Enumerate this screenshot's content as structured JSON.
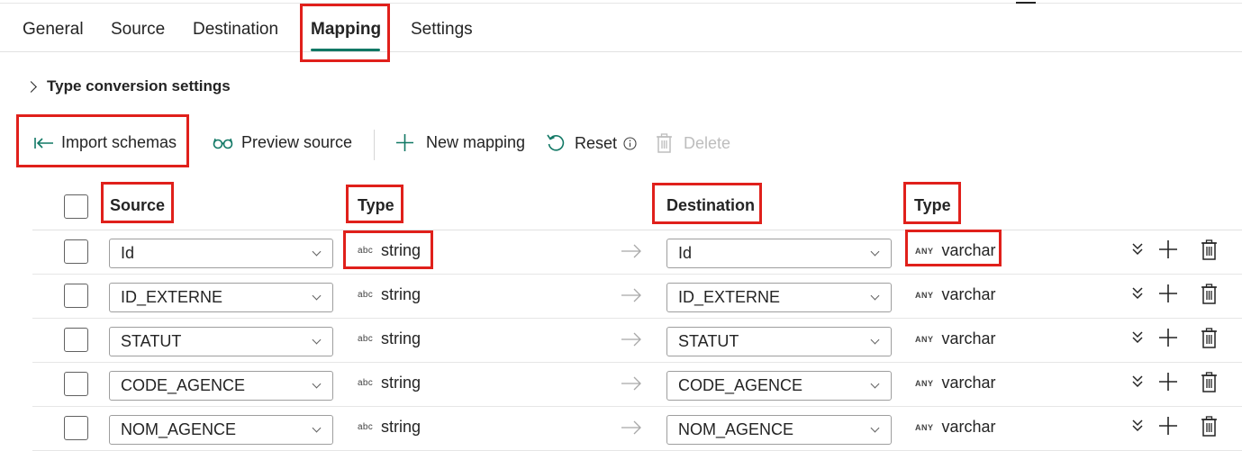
{
  "tabs": [
    {
      "label": "General"
    },
    {
      "label": "Source"
    },
    {
      "label": "Destination"
    },
    {
      "label": "Mapping",
      "active": true
    },
    {
      "label": "Settings"
    }
  ],
  "type_conversion": {
    "label": "Type conversion settings"
  },
  "toolbar": {
    "import_schemas": "Import schemas",
    "preview_source": "Preview source",
    "new_mapping": "New mapping",
    "reset": "Reset",
    "delete": "Delete"
  },
  "headers": {
    "source": "Source",
    "source_type": "Type",
    "destination": "Destination",
    "destination_type": "Type"
  },
  "rows": [
    {
      "source": "Id",
      "source_type_abbr": "abc",
      "source_type": "string",
      "destination": "Id",
      "dest_type_abbr": "ANY",
      "dest_type": "varchar"
    },
    {
      "source": "ID_EXTERNE",
      "source_type_abbr": "abc",
      "source_type": "string",
      "destination": "ID_EXTERNE",
      "dest_type_abbr": "ANY",
      "dest_type": "varchar"
    },
    {
      "source": "STATUT",
      "source_type_abbr": "abc",
      "source_type": "string",
      "destination": "STATUT",
      "dest_type_abbr": "ANY",
      "dest_type": "varchar"
    },
    {
      "source": "CODE_AGENCE",
      "source_type_abbr": "abc",
      "source_type": "string",
      "destination": "CODE_AGENCE",
      "dest_type_abbr": "ANY",
      "dest_type": "varchar"
    },
    {
      "source": "NOM_AGENCE",
      "source_type_abbr": "abc",
      "source_type": "string",
      "destination": "NOM_AGENCE",
      "dest_type_abbr": "ANY",
      "dest_type": "varchar"
    }
  ],
  "colors": {
    "accent": "#117865",
    "highlight": "#e0201b",
    "disabled": "#bdbdbd"
  }
}
